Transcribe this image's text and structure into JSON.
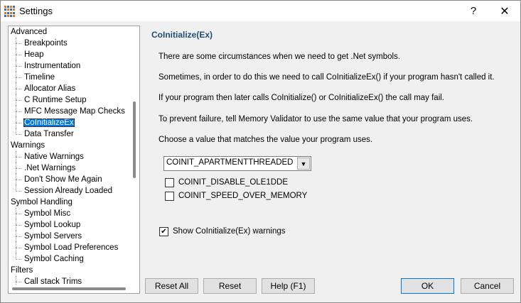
{
  "window": {
    "title": "Settings",
    "help_glyph": "?",
    "close_glyph": "✕"
  },
  "tree": {
    "items": [
      {
        "label": "Advanced",
        "level": 0
      },
      {
        "label": "Breakpoints",
        "level": 1
      },
      {
        "label": "Heap",
        "level": 1
      },
      {
        "label": "Instrumentation",
        "level": 1
      },
      {
        "label": "Timeline",
        "level": 1
      },
      {
        "label": "Allocator Alias",
        "level": 1
      },
      {
        "label": "C Runtime Setup",
        "level": 1
      },
      {
        "label": "MFC Message Map Checks",
        "level": 1
      },
      {
        "label": "CoInitializeEx",
        "level": 1,
        "selected": true
      },
      {
        "label": "Data Transfer",
        "level": 1,
        "last": true
      },
      {
        "label": "Warnings",
        "level": 0
      },
      {
        "label": "Native Warnings",
        "level": 1
      },
      {
        "label": ".Net Warnings",
        "level": 1
      },
      {
        "label": "Don't Show Me Again",
        "level": 1
      },
      {
        "label": "Session Already Loaded",
        "level": 1,
        "last": true
      },
      {
        "label": "Symbol Handling",
        "level": 0
      },
      {
        "label": "Symbol Misc",
        "level": 1
      },
      {
        "label": "Symbol Lookup",
        "level": 1
      },
      {
        "label": "Symbol Servers",
        "level": 1
      },
      {
        "label": "Symbol Load Preferences",
        "level": 1
      },
      {
        "label": "Symbol Caching",
        "level": 1,
        "last": true
      },
      {
        "label": "Filters",
        "level": 0
      },
      {
        "label": "Call stack Trims",
        "level": 1
      }
    ]
  },
  "panel": {
    "title": "CoInitialize(Ex)",
    "paragraphs": [
      "There are some circumstances when we need to get .Net symbols.",
      "Sometimes, in order to do this we need to call CoInitializeEx() if your program hasn't called it.",
      "If your program then later calls CoInitialize() or CoInitializeEx() the call may fail.",
      "To prevent failure, tell Memory Validator to use the same value that your program uses.",
      "Choose a value that matches the value your program uses."
    ],
    "combo_value": "COINIT_APARTMENTTHREADED",
    "combo_arrow": "▼",
    "options": [
      {
        "label": "COINIT_DISABLE_OLE1DDE",
        "checked": false
      },
      {
        "label": "COINIT_SPEED_OVER_MEMORY",
        "checked": false
      }
    ],
    "show_warnings": {
      "label": "Show CoInitialize(Ex) warnings",
      "checked": true
    }
  },
  "buttons": {
    "reset_all": "Reset All",
    "reset": "Reset",
    "help": "Help (F1)",
    "ok": "OK",
    "cancel": "Cancel"
  }
}
